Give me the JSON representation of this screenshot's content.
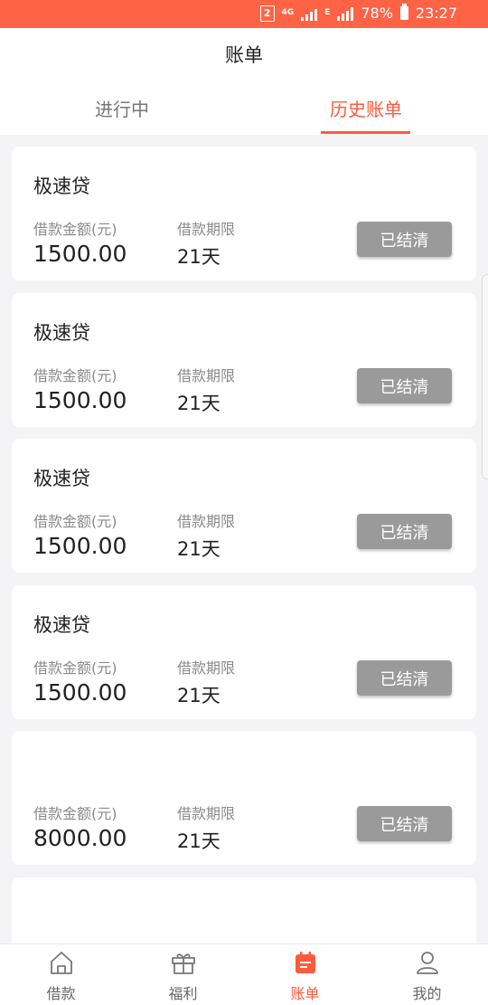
{
  "status_bar": {
    "badge": "2",
    "network": "4G",
    "network_sub": "E",
    "battery": "78%",
    "time": "23:27"
  },
  "header": {
    "title": "账单"
  },
  "tabs": [
    {
      "label": "进行中",
      "active": false
    },
    {
      "label": "历史账单",
      "active": true
    }
  ],
  "bills": [
    {
      "title": "极速贷",
      "amount_label": "借款金额(元)",
      "amount": "1500.00",
      "term_label": "借款期限",
      "term": "21天",
      "status": "已结清"
    },
    {
      "title": "极速贷",
      "amount_label": "借款金额(元)",
      "amount": "1500.00",
      "term_label": "借款期限",
      "term": "21天",
      "status": "已结清"
    },
    {
      "title": "极速贷",
      "amount_label": "借款金额(元)",
      "amount": "1500.00",
      "term_label": "借款期限",
      "term": "21天",
      "status": "已结清"
    },
    {
      "title": "极速贷",
      "amount_label": "借款金额(元)",
      "amount": "1500.00",
      "term_label": "借款期限",
      "term": "21天",
      "status": "已结清"
    },
    {
      "title": "",
      "amount_label": "借款金额(元)",
      "amount": "8000.00",
      "term_label": "借款期限",
      "term": "21天",
      "status": "已结清"
    }
  ],
  "bottom_nav": [
    {
      "label": "借款",
      "icon": "home-icon"
    },
    {
      "label": "福利",
      "icon": "gift-icon"
    },
    {
      "label": "账单",
      "icon": "bill-icon",
      "active": true
    },
    {
      "label": "我的",
      "icon": "user-icon"
    }
  ],
  "colors": {
    "accent": "#ff5a3c",
    "status_bar": "#ff6346",
    "settled_button": "#9a9a9a"
  }
}
